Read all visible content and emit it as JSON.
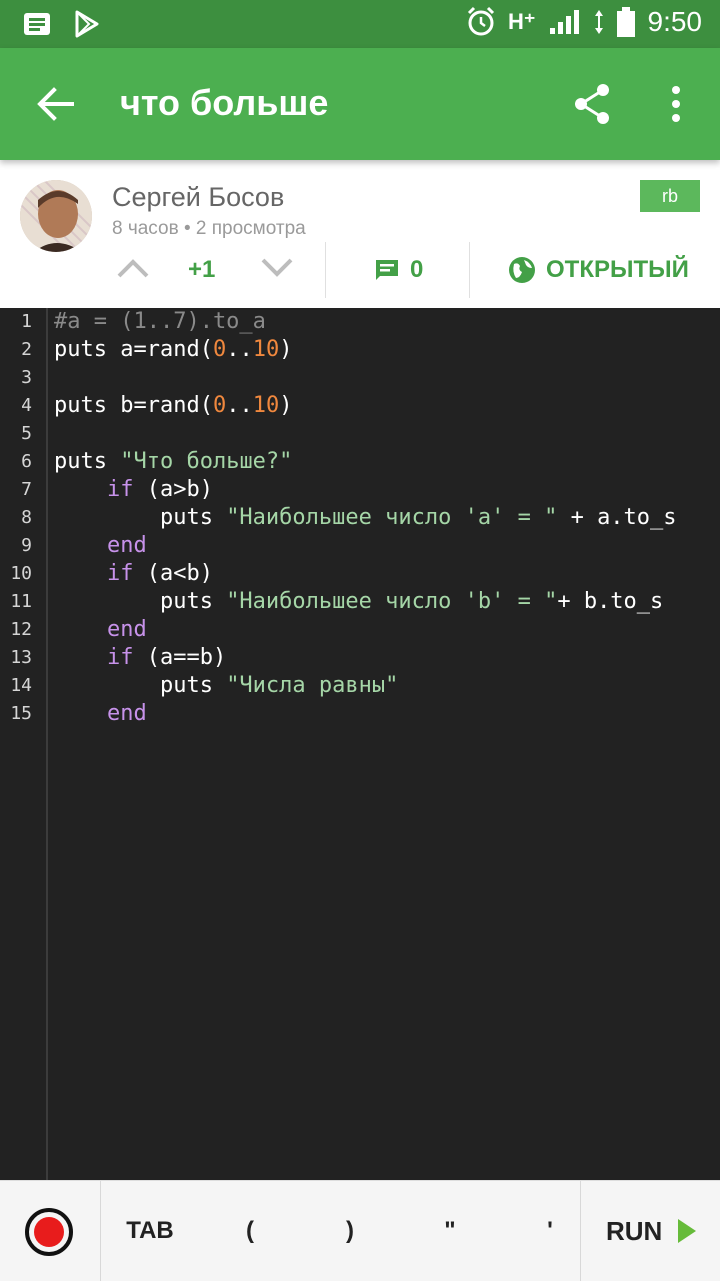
{
  "status_bar": {
    "time": "9:50",
    "network": "H⁺",
    "icons": [
      "notification-icon",
      "play-store-icon",
      "alarm-icon",
      "signal-icon",
      "data-arrows-icon",
      "battery-icon"
    ]
  },
  "toolbar": {
    "title": "что больше",
    "icons": [
      "back-arrow-icon",
      "share-icon",
      "more-vert-icon"
    ]
  },
  "post": {
    "author": "Сергей Босов",
    "meta": "8 часов • 2 просмотра",
    "language": "rb",
    "votes": "+1",
    "comments": "0",
    "visibility": "ОТКРЫТЫЙ"
  },
  "code": {
    "line_numbers": [
      "1",
      "2",
      "3",
      "4",
      "5",
      "6",
      "7",
      "8",
      "9",
      "10",
      "11",
      "12",
      "13",
      "14",
      "15"
    ],
    "lines": [
      [
        {
          "t": "#a = (1..7).to_a",
          "c": "comment"
        }
      ],
      [
        {
          "t": "puts a=rand(",
          "c": ""
        },
        {
          "t": "0",
          "c": "num"
        },
        {
          "t": "..",
          "c": ""
        },
        {
          "t": "10",
          "c": "num"
        },
        {
          "t": ")",
          "c": ""
        }
      ],
      [],
      [
        {
          "t": "puts b=rand(",
          "c": ""
        },
        {
          "t": "0",
          "c": "num"
        },
        {
          "t": "..",
          "c": ""
        },
        {
          "t": "10",
          "c": "num"
        },
        {
          "t": ")",
          "c": ""
        }
      ],
      [],
      [
        {
          "t": "puts ",
          "c": ""
        },
        {
          "t": "\"Что больше?\"",
          "c": "str"
        }
      ],
      [
        {
          "t": "    ",
          "c": ""
        },
        {
          "t": "if",
          "c": "kw"
        },
        {
          "t": " (a>b)",
          "c": ""
        }
      ],
      [
        {
          "t": "        puts ",
          "c": ""
        },
        {
          "t": "\"Наибольшее число 'a' = \"",
          "c": "str"
        },
        {
          "t": " + a.to_s",
          "c": ""
        }
      ],
      [
        {
          "t": "    ",
          "c": ""
        },
        {
          "t": "end",
          "c": "kw"
        }
      ],
      [
        {
          "t": "    ",
          "c": ""
        },
        {
          "t": "if",
          "c": "kw"
        },
        {
          "t": " (a<b)",
          "c": ""
        }
      ],
      [
        {
          "t": "        puts ",
          "c": ""
        },
        {
          "t": "\"Наибольшее число 'b' = \"",
          "c": "str"
        },
        {
          "t": "+ b.to_s",
          "c": ""
        }
      ],
      [
        {
          "t": "    ",
          "c": ""
        },
        {
          "t": "end",
          "c": "kw"
        }
      ],
      [
        {
          "t": "    ",
          "c": ""
        },
        {
          "t": "if",
          "c": "kw"
        },
        {
          "t": " (a==b)",
          "c": ""
        }
      ],
      [
        {
          "t": "        puts ",
          "c": ""
        },
        {
          "t": "\"Числа равны\"",
          "c": "str"
        }
      ],
      [
        {
          "t": "    ",
          "c": ""
        },
        {
          "t": "end",
          "c": "kw"
        }
      ]
    ]
  },
  "keybar": {
    "keys": [
      "TAB",
      "(",
      ")",
      "\"",
      "'"
    ],
    "run_label": "RUN"
  },
  "colors": {
    "status_bar": "#3d8f3f",
    "toolbar": "#4caf50",
    "accent": "#43a047",
    "editor_bg": "#222222",
    "number": "#f0883e",
    "string": "#a5d6a7",
    "keyword": "#c792ea",
    "comment": "#8a8a8a"
  }
}
